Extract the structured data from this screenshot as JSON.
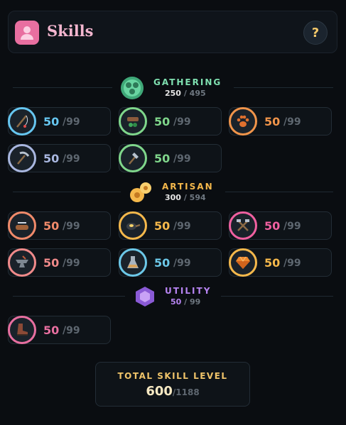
{
  "header": {
    "title": "Skills",
    "help_label": "?",
    "accent": "#e86fa0"
  },
  "sections": {
    "gathering": {
      "name": "GATHERING",
      "current": "250",
      "max": "/ 495",
      "color": "#7fe0b0",
      "skills": [
        {
          "icon": "fishing-rod-icon",
          "level": "50",
          "max": "/99",
          "color": "#66c6f0"
        },
        {
          "icon": "foraging-bundle-icon",
          "level": "50",
          "max": "/99",
          "color": "#7fd68b"
        },
        {
          "icon": "paw-print-icon",
          "level": "50",
          "max": "/99",
          "color": "#f0944a"
        },
        {
          "icon": "pickaxe-icon",
          "level": "50",
          "max": "/99",
          "color": "#a9b7e0"
        },
        {
          "icon": "hatchet-icon",
          "level": "50",
          "max": "/99",
          "color": "#7fd68b"
        }
      ]
    },
    "artisan": {
      "name": "ARTISAN",
      "current": "300",
      "max": "/ 594",
      "color": "#f5b84b",
      "skills": [
        {
          "icon": "log-saw-icon",
          "level": "50",
          "max": "/99",
          "color": "#f08a6a"
        },
        {
          "icon": "frying-pan-icon",
          "level": "50",
          "max": "/99",
          "color": "#f5b84b"
        },
        {
          "icon": "crossed-hammers-icon",
          "level": "50",
          "max": "/99",
          "color": "#f060a0"
        },
        {
          "icon": "anvil-icon",
          "level": "50",
          "max": "/99",
          "color": "#f08a8a"
        },
        {
          "icon": "lab-flask-icon",
          "level": "50",
          "max": "/99",
          "color": "#6cc8e8"
        },
        {
          "icon": "gem-icon",
          "level": "50",
          "max": "/99",
          "color": "#f5b84b"
        }
      ]
    },
    "utility": {
      "name": "UTILITY",
      "current": "50",
      "max": "/ 99",
      "color": "#b784f2",
      "skills": [
        {
          "icon": "boot-icon",
          "level": "50",
          "max": "/99",
          "color": "#e86fa0"
        }
      ]
    }
  },
  "total": {
    "label": "TOTAL SKILL LEVEL",
    "value": "600",
    "max": "/1188"
  }
}
